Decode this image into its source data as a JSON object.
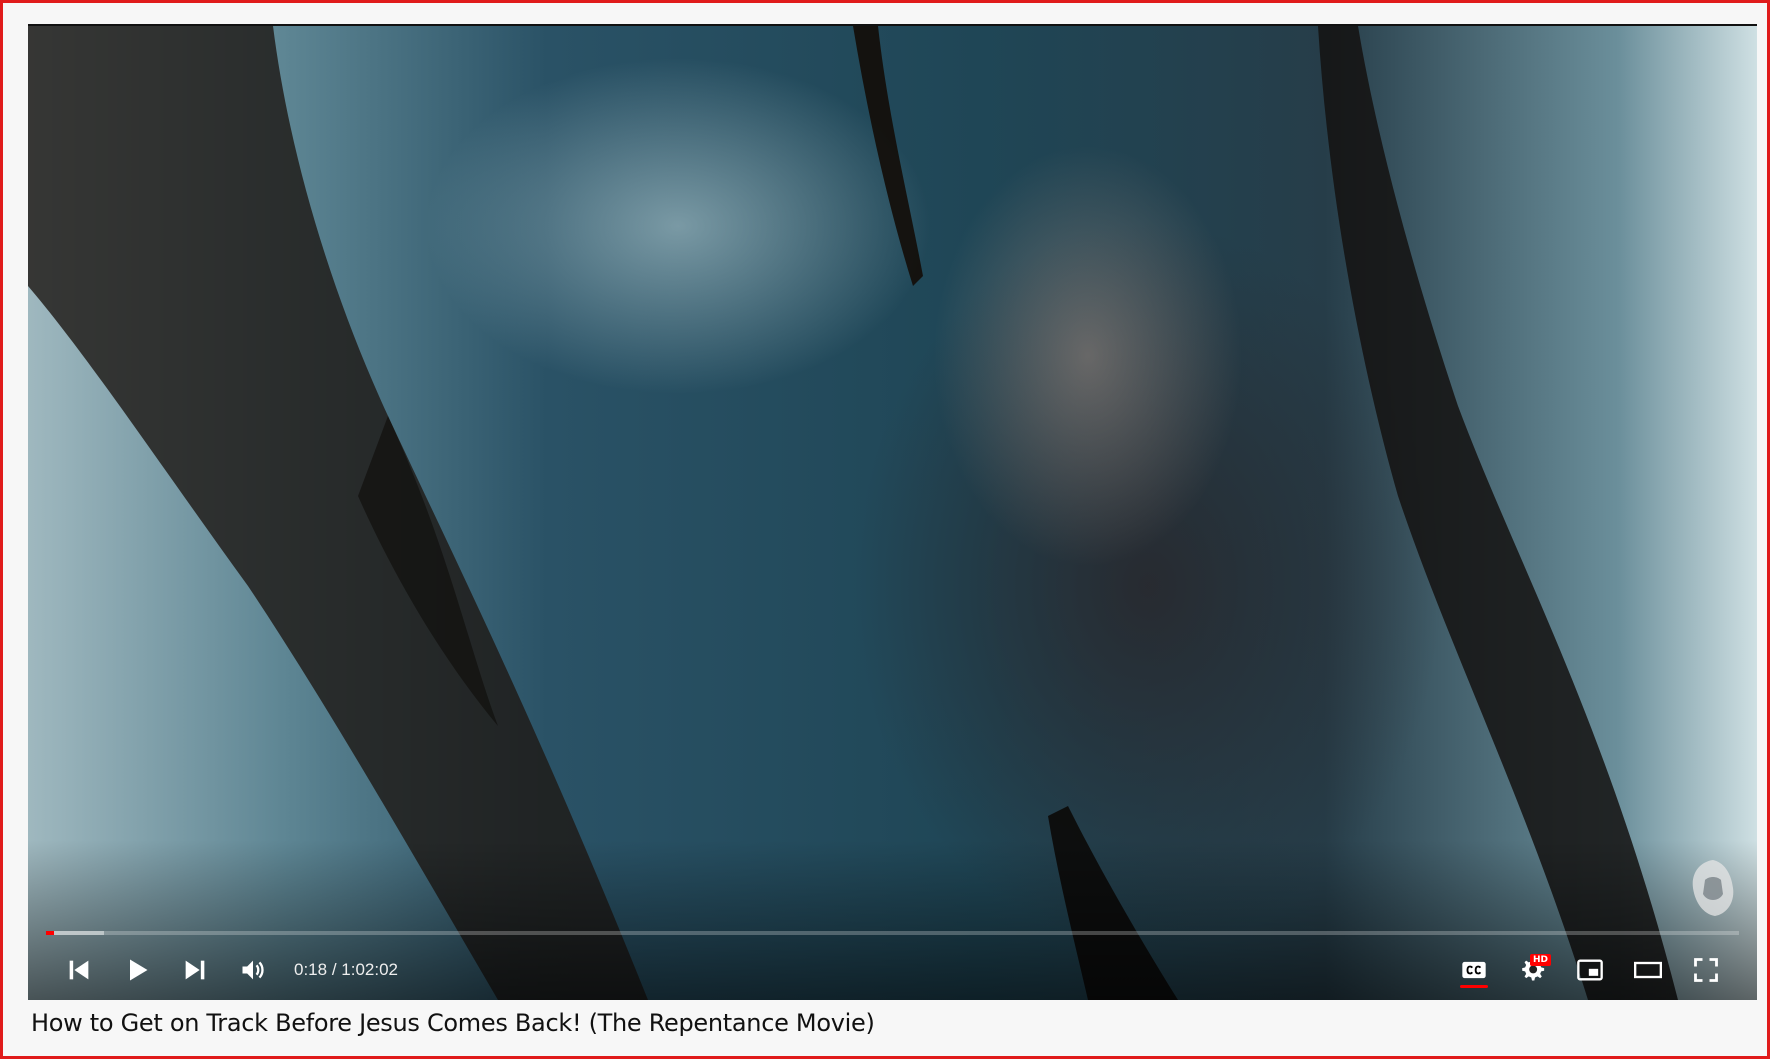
{
  "video": {
    "title": "How to Get on Track Before Jesus Comes Back! (The Repentance Movie)",
    "current_time": "0:18",
    "duration": "1:02:02",
    "time_separator": " / ",
    "progress_played": 0.0048,
    "progress_loaded": 0.034
  },
  "controls": {
    "left": [
      "previous-icon",
      "play-icon",
      "next-icon",
      "volume-icon"
    ],
    "right": [
      "closed-captions-icon",
      "settings-icon",
      "miniplayer-icon",
      "theater-mode-icon",
      "fullscreen-icon"
    ],
    "settings_badge": "HD"
  },
  "colors": {
    "accent": "#ff0000",
    "frame_border": "#e01b1b",
    "title_text": "#111111"
  }
}
